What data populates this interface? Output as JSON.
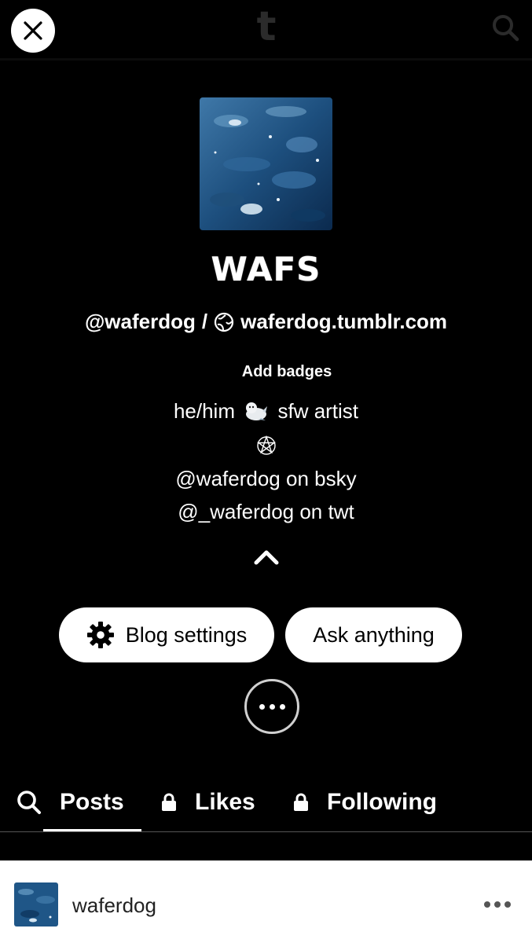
{
  "topbar": {
    "close_icon": "close-icon",
    "logo_text": "t",
    "search_icon": "search-icon"
  },
  "blog": {
    "title": "WAFS",
    "handle": "@waferdog",
    "separator": "/",
    "url": "waferdog.tumblr.com",
    "add_badges": "Add badges",
    "description": {
      "line1_pre": "he/him",
      "line1_post": "sfw artist",
      "line2_icon": "pentagram-icon",
      "line3": "@waferdog on bsky",
      "line4": "@_waferdog on twt"
    }
  },
  "actions": {
    "settings_label": "Blog settings",
    "ask_label": "Ask anything"
  },
  "tabs": [
    {
      "label": "Posts",
      "icon": "search-icon",
      "active": true
    },
    {
      "label": "Likes",
      "icon": "lock-icon",
      "active": false
    },
    {
      "label": "Following",
      "icon": "lock-icon",
      "active": false
    }
  ],
  "post": {
    "author": "waferdog"
  },
  "colors": {
    "background": "#000000",
    "text": "#ffffff",
    "pill": "#ffffff",
    "post_card": "#ffffff"
  }
}
